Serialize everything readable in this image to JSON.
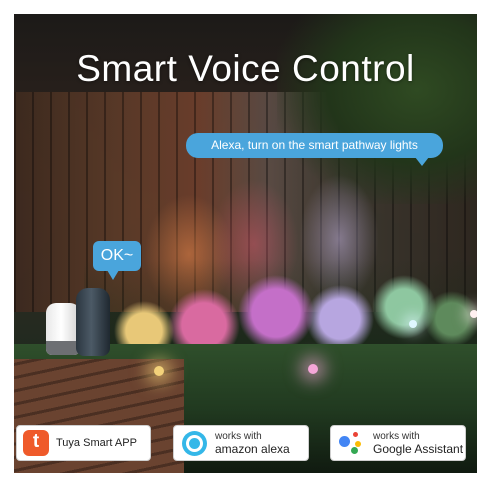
{
  "title": "Smart Voice Control",
  "bubbles": {
    "alexa_command": "Alexa, turn on the smart pathway lights",
    "ok_response": "OK~"
  },
  "badges": {
    "tuya": {
      "label": "Tuya Smart APP",
      "icon": "tuya-app-icon"
    },
    "alexa": {
      "line1": "works with",
      "line2": "amazon alexa",
      "icon": "alexa-ring-icon"
    },
    "google": {
      "line1": "works with",
      "line2": "Google Assistant",
      "icon": "google-assistant-dots-icon"
    }
  },
  "colors": {
    "bubble": "#4aa5dc",
    "tuya": "#ef5a2a",
    "alexa": "#34b7e8",
    "google_blue": "#4285f4",
    "google_red": "#ea4335",
    "google_yellow": "#fbbc05",
    "google_green": "#34a853"
  }
}
